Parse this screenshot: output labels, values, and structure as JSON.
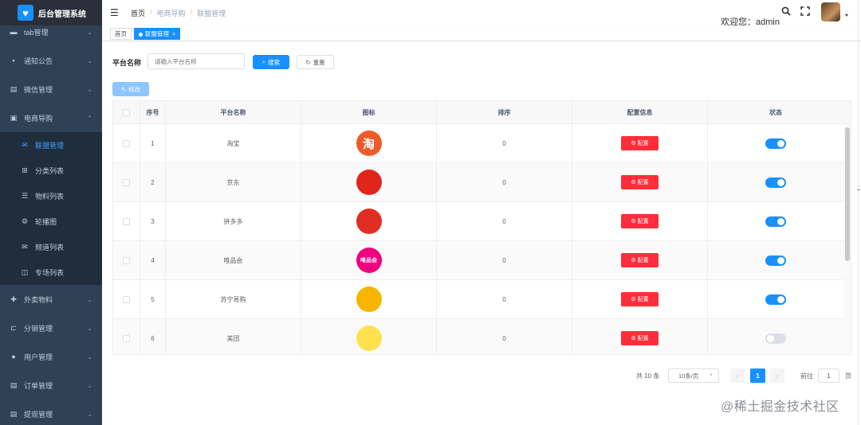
{
  "app": {
    "title": "后台管理系统",
    "logo_icon": "heart-icon"
  },
  "sidebar": {
    "items": [
      {
        "label": "tab管理",
        "icon": "folder-icon"
      },
      {
        "label": "通知公告",
        "icon": "message-icon"
      },
      {
        "label": "微信管理",
        "icon": "document-icon"
      },
      {
        "label": "电商导购",
        "icon": "shop-icon",
        "expanded": true
      },
      {
        "label": "外卖物料",
        "icon": "move-icon"
      },
      {
        "label": "分销管理",
        "icon": "share-icon"
      },
      {
        "label": "用户管理",
        "icon": "user-icon"
      },
      {
        "label": "订单管理",
        "icon": "order-icon"
      },
      {
        "label": "提现管理",
        "icon": "withdraw-icon"
      }
    ],
    "subitems": [
      {
        "label": "联盟管理",
        "icon": "mail-icon",
        "active": true
      },
      {
        "label": "分类列表",
        "icon": "category-icon"
      },
      {
        "label": "物料列表",
        "icon": "list-icon"
      },
      {
        "label": "轮播图",
        "icon": "carousel-icon"
      },
      {
        "label": "频道列表",
        "icon": "channel-icon"
      },
      {
        "label": "专场列表",
        "icon": "book-icon"
      }
    ]
  },
  "header": {
    "breadcrumb": [
      "首页",
      "电商导购",
      "联盟管理"
    ],
    "welcome": "欢迎您：admin"
  },
  "tags": [
    {
      "label": "首页",
      "active": false
    },
    {
      "label": "联盟管理",
      "active": true
    }
  ],
  "search": {
    "label": "平台名称",
    "placeholder": "请输入平台名称",
    "search_btn": "搜索",
    "reset_btn": "重置"
  },
  "toolbar": {
    "edit_btn": "修改"
  },
  "table": {
    "headers": [
      "序号",
      "平台名称",
      "图标",
      "排序",
      "配置信息",
      "状态"
    ],
    "config_btn": "配置",
    "rows": [
      {
        "index": "1",
        "name": "淘宝",
        "sort": "0",
        "status": true,
        "logo_color": "#f05a28",
        "logo_text": "淘"
      },
      {
        "index": "2",
        "name": "京东",
        "sort": "0",
        "status": true,
        "logo_color": "#e1251b",
        "logo_text": ""
      },
      {
        "index": "3",
        "name": "拼多多",
        "sort": "0",
        "status": true,
        "logo_color": "#e02e24",
        "logo_text": ""
      },
      {
        "index": "4",
        "name": "唯品会",
        "sort": "0",
        "status": true,
        "logo_color": "#f10180",
        "logo_text": "唯品会"
      },
      {
        "index": "5",
        "name": "苏宁易购",
        "sort": "0",
        "status": true,
        "logo_color": "#f7b500",
        "logo_text": ""
      },
      {
        "index": "6",
        "name": "美团",
        "sort": "0",
        "status": false,
        "logo_color": "#ffe14d",
        "logo_text": ""
      }
    ]
  },
  "pagination": {
    "total": "共 10 条",
    "page_size": "10条/页",
    "current_page": "1",
    "goto_label": "前往",
    "goto_value": "1",
    "page_suffix": "页"
  },
  "watermark": "@稀土掘金技术社区"
}
